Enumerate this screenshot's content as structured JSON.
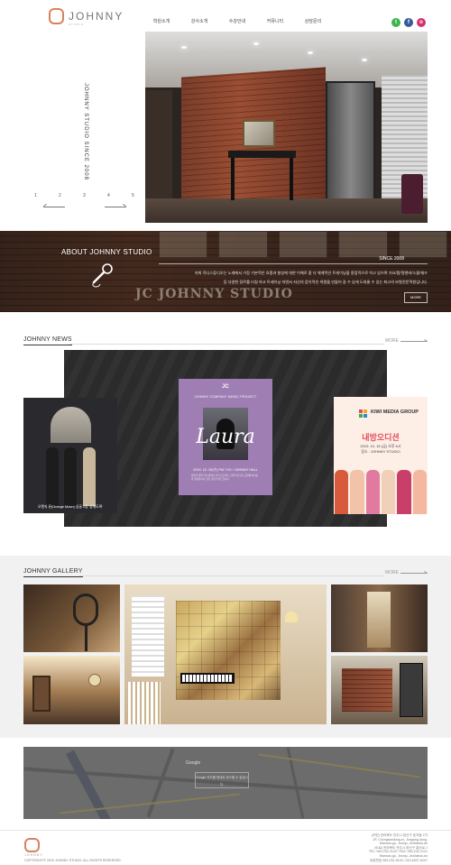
{
  "brand": {
    "name": "JOHNNY",
    "sub": "STUDIO",
    "accent": "#d9825b"
  },
  "nav": {
    "items": [
      "학원소개",
      "강사소개",
      "수강안내",
      "커뮤니티",
      "상담문의"
    ]
  },
  "social": [
    {
      "icon": "kakao-icon",
      "glyph": "t",
      "color": "#3cb54a"
    },
    {
      "icon": "facebook-icon",
      "glyph": "f",
      "color": "#3b5998"
    },
    {
      "icon": "instagram-icon",
      "glyph": "o",
      "color": "#d6316f"
    }
  ],
  "hero": {
    "vertical_text": "JOHNNY STUDIO SINCE 2008",
    "slides": [
      "1",
      "2",
      "3",
      "4",
      "5"
    ]
  },
  "about": {
    "title": "ABOUT JOHNNY STUDIO",
    "since": "SINCE 2008",
    "sign": "JC JOHNNY STUDIO",
    "text": "저희 쟈니스튜디오는 노래에서 가장 기본적인 호흡과 발성에 대한 이해로 좀 더 체계적인 트레이닝을 중점적으로 하고 있으며 가요/팝/알앤비/소울/재즈 등 다양한 장르를 티칭 하고 트레이닝 하면서 자신의 음악적인 색깔을 만들어 갈 수 있게 도와줄 수 있는 최고의 보컬전문학원입니다.",
    "more": "MORE"
  },
  "news": {
    "title": "JOHNNY NEWS",
    "more": "MORE",
    "left_caption": "오렌지 뮤(Orange Moon) 싱글 2집 '방해도록'",
    "mid": {
      "logo": "JC",
      "project": "JOHNNY COMPANY MUSIC PROJECT",
      "title": "Laura",
      "date": "2019. 12. 25(수) PM 7:00 / JOHNNY HALL",
      "desc": "따뜻한 연말 쟈니 컴퍼니 뮤직 프로젝트 로라의 첫 단독 공연에 여러분을 초대합니다. 많은 관심 부탁드립니다."
    },
    "right": {
      "brand": "KIWI MEDIA GROUP",
      "title": "내방오디션",
      "date": "2019. 10. 18 (금) 오후 6시",
      "place": "장소 : JOHNNY STUDIO"
    }
  },
  "gallery": {
    "title": "JOHNNY GALLERY",
    "more": "MORE"
  },
  "map": {
    "label": "Google",
    "notice": "Google 지도를 제대로 로드할 수 없습니다."
  },
  "footer": {
    "logo_text": "JOHNNY",
    "copyright": "COPYRIGHT© 2019 JOHNNY STUDIO. ALL RIGHTS RESERVED.",
    "address_lines": [
      "(지번) 전라북도 전주시 완산구 효자동 2가",
      "2F, Chungsandong-ro, Jungang-dong,",
      "Wansan-gu, Jeonju, Jeollabuk-do",
      "(도로) 전라북도 전주시 완산구 홍산로 1",
      "TEL: 063-232-2120 / FAX: 063-232-2121",
      "Wansan-gu, Jeonju, Jeollabuk-do",
      "대표번호 063-232-8100 / 010-6307-8107"
    ]
  }
}
